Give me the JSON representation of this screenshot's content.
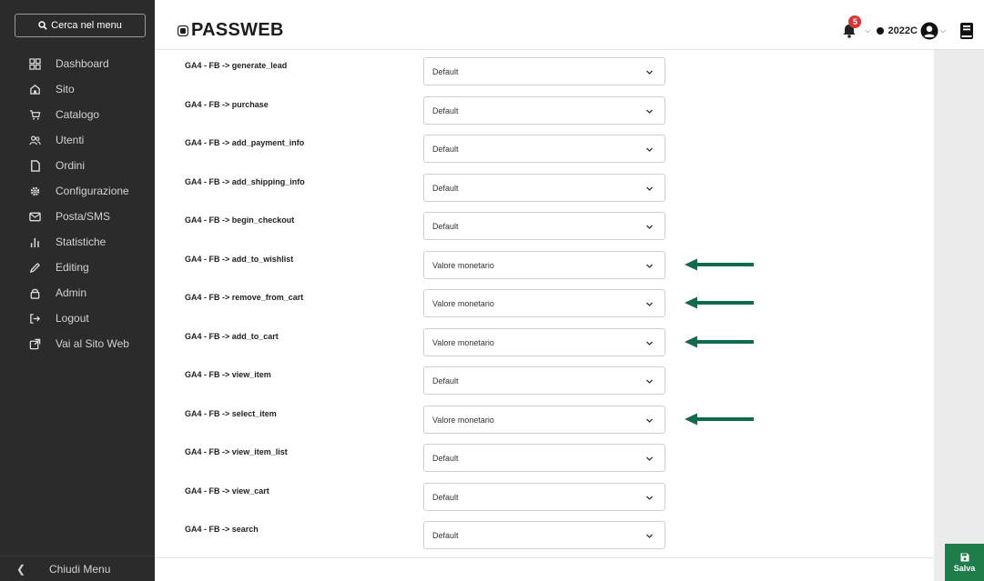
{
  "sidebar": {
    "search_label": "Cerca nel menu",
    "items": [
      {
        "label": "Dashboard",
        "icon": "dashboard-icon"
      },
      {
        "label": "Sito",
        "icon": "home-icon"
      },
      {
        "label": "Catalogo",
        "icon": "cart-icon"
      },
      {
        "label": "Utenti",
        "icon": "users-icon"
      },
      {
        "label": "Ordini",
        "icon": "file-icon"
      },
      {
        "label": "Configurazione",
        "icon": "gear-icon"
      },
      {
        "label": "Posta/SMS",
        "icon": "envelope-icon"
      },
      {
        "label": "Statistiche",
        "icon": "bar-chart-icon"
      },
      {
        "label": "Editing",
        "icon": "pencil-icon"
      },
      {
        "label": "Admin",
        "icon": "lock-icon"
      },
      {
        "label": "Logout",
        "icon": "logout-icon"
      },
      {
        "label": "Vai al Sito Web",
        "icon": "external-link-icon"
      }
    ],
    "close_label": "Chiudi Menu"
  },
  "header": {
    "logo_text": "PASSWEB",
    "notification_count": "5",
    "user_code": "2022C"
  },
  "rows": [
    {
      "label": "GA4 - FB -> generate_lead",
      "value": "Default",
      "highlighted": false
    },
    {
      "label": "GA4 - FB -> purchase",
      "value": "Default",
      "highlighted": false
    },
    {
      "label": "GA4 - FB -> add_payment_info",
      "value": "Default",
      "highlighted": false
    },
    {
      "label": "GA4 - FB -> add_shipping_info",
      "value": "Default",
      "highlighted": false
    },
    {
      "label": "GA4 - FB -> begin_checkout",
      "value": "Default",
      "highlighted": false
    },
    {
      "label": "GA4 - FB -> add_to_wishlist",
      "value": "Valore monetario",
      "highlighted": true
    },
    {
      "label": "GA4 - FB -> remove_from_cart",
      "value": "Valore monetario",
      "highlighted": true
    },
    {
      "label": "GA4 - FB -> add_to_cart",
      "value": "Valore monetario",
      "highlighted": true
    },
    {
      "label": "GA4 - FB -> view_item",
      "value": "Default",
      "highlighted": false
    },
    {
      "label": "GA4 - FB -> select_item",
      "value": "Valore monetario",
      "highlighted": true
    },
    {
      "label": "GA4 - FB -> view_item_list",
      "value": "Default",
      "highlighted": false
    },
    {
      "label": "GA4 - FB -> view_cart",
      "value": "Default",
      "highlighted": false
    },
    {
      "label": "GA4 - FB -> search",
      "value": "Default",
      "highlighted": false
    }
  ],
  "save": {
    "label": "Salva"
  },
  "colors": {
    "sidebar_bg": "#2b2b2b",
    "accent_green": "#1e7d4b",
    "arrow_green": "#0f6b4a",
    "badge_red": "#dd3333"
  }
}
